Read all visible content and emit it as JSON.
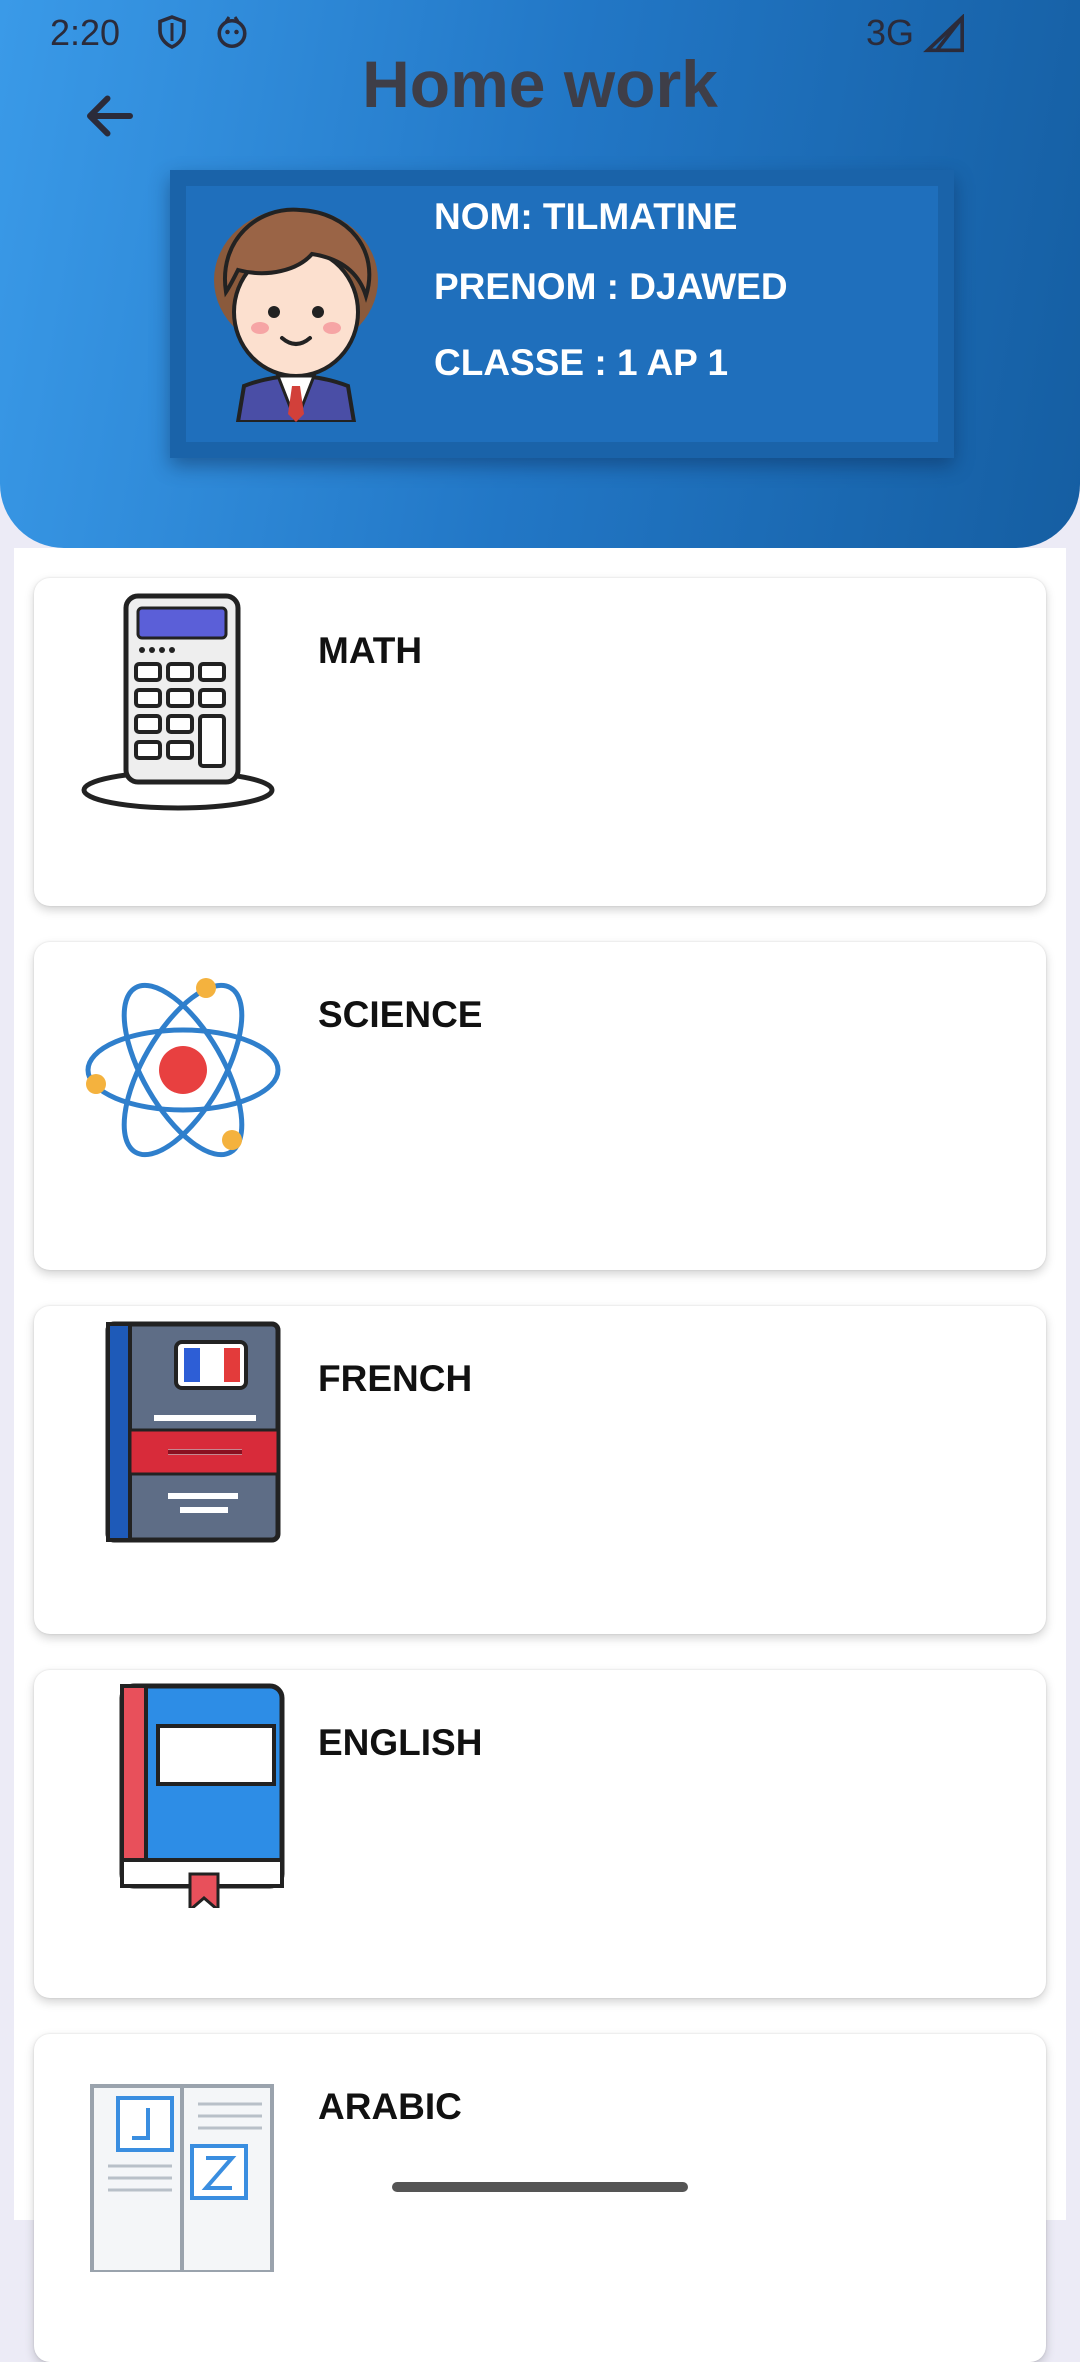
{
  "status_bar": {
    "time": "2:20",
    "network": "3G",
    "icons": [
      "shield-icon",
      "face-icon",
      "signal-icon"
    ]
  },
  "header": {
    "title": "Home work",
    "back_icon": "arrow-left-icon"
  },
  "student": {
    "nom": "NOM: TILMATINE",
    "prenom": "PRENOM : DJAWED",
    "classe": "CLASSE : 1 AP 1",
    "avatar_icon": "student-avatar-icon"
  },
  "subjects": [
    {
      "label": "MATH",
      "icon": "calculator-icon"
    },
    {
      "label": "SCIENCE",
      "icon": "atom-icon"
    },
    {
      "label": "FRENCH",
      "icon": "french-book-icon"
    },
    {
      "label": "ENGLISH",
      "icon": "english-book-icon"
    },
    {
      "label": "ARABIC",
      "icon": "arabic-book-icon"
    }
  ],
  "colors": {
    "header_start": "#3a9ae8",
    "header_end": "#155ea2",
    "card_bg": "#1f6fbc"
  }
}
